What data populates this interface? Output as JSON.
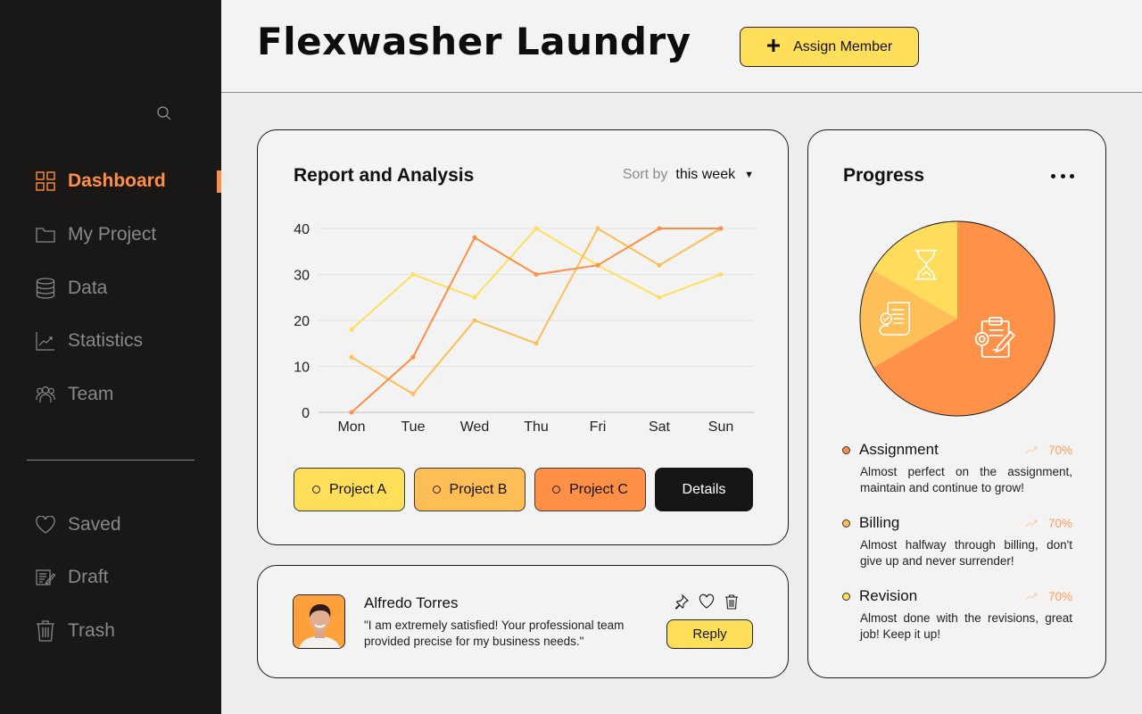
{
  "app": {
    "title": "Flexwasher Laundry"
  },
  "header": {
    "assign_button": {
      "icon": "plus-icon",
      "label": "Assign Member"
    }
  },
  "sidebar": {
    "search_icon": "search-icon",
    "items": [
      {
        "label": "Dashboard",
        "icon": "grid-icon",
        "active": true
      },
      {
        "label": "My Project",
        "icon": "folder-icon",
        "active": false
      },
      {
        "label": "Data",
        "icon": "database-icon",
        "active": false
      },
      {
        "label": "Statistics",
        "icon": "chart-line-icon",
        "active": false
      },
      {
        "label": "Team",
        "icon": "team-icon",
        "active": false
      }
    ],
    "secondary_items": [
      {
        "label": "Saved",
        "icon": "heart-icon"
      },
      {
        "label": "Draft",
        "icon": "draft-icon"
      },
      {
        "label": "Trash",
        "icon": "trash-icon"
      }
    ]
  },
  "report": {
    "title": "Report and Analysis",
    "sort_label": "Sort by",
    "sort_value": "this week",
    "buttons": [
      {
        "label": "Project A",
        "color": "#ffdf5a"
      },
      {
        "label": "Project B",
        "color": "#ffbd55"
      },
      {
        "label": "Project C",
        "color": "#ff8f45"
      }
    ],
    "details_label": "Details"
  },
  "chart_data": [
    {
      "type": "line",
      "title": "Report and Analysis",
      "xlabel": "",
      "ylabel": "",
      "categories": [
        "Mon",
        "Tue",
        "Wed",
        "Thu",
        "Fri",
        "Sat",
        "Sun"
      ],
      "ylim": [
        0,
        40
      ],
      "yticks": [
        0,
        10,
        20,
        30,
        40
      ],
      "grid": true,
      "series": [
        {
          "name": "Project A",
          "color": "#ffdf5a",
          "values": [
            18,
            30,
            25,
            40,
            32,
            25,
            30
          ]
        },
        {
          "name": "Project B",
          "color": "#ffbd55",
          "values": [
            12,
            4,
            20,
            15,
            40,
            32,
            40
          ]
        },
        {
          "name": "Project C",
          "color": "#ff8f45",
          "values": [
            0,
            12,
            38,
            30,
            32,
            40,
            40
          ]
        }
      ]
    },
    {
      "type": "pie",
      "title": "Progress",
      "slices": [
        {
          "name": "Assignment",
          "value": 66.7,
          "color": "#ff9248",
          "icon": "clipboard-gear-icon"
        },
        {
          "name": "Billing",
          "value": 16.7,
          "color": "#ffbf58",
          "icon": "receipt-check-icon"
        },
        {
          "name": "Revision",
          "value": 16.7,
          "color": "#ffdc5c",
          "icon": "hourglass-icon"
        }
      ]
    }
  ],
  "review": {
    "name": "Alfredo Torres",
    "text": "\"I am extremely satisfied! Your professional team provided precise for my business needs.\"",
    "actions": [
      "pin-icon",
      "heart-icon",
      "trash-icon"
    ],
    "reply_label": "Reply"
  },
  "progress": {
    "title": "Progress",
    "menu_icon": "more-horizontal-icon",
    "items": [
      {
        "name": "Assignment",
        "percent": "70%",
        "color": "#ff8f45",
        "desc": "Almost perfect on the assignment, maintain and continue to grow!"
      },
      {
        "name": "Billing",
        "percent": "70%",
        "color": "#ffbd55",
        "desc": "Almost halfway through billing, don't give up and never surrender!"
      },
      {
        "name": "Revision",
        "percent": "70%",
        "color": "#ffdf5a",
        "desc": "Almost done with the revisions, great job! Keep it up!"
      }
    ]
  }
}
